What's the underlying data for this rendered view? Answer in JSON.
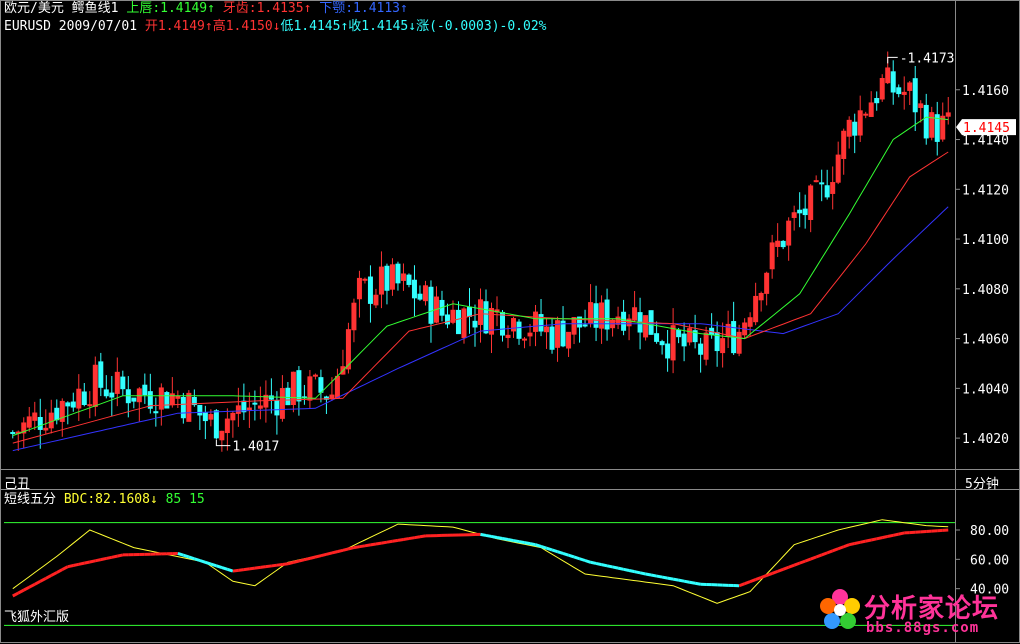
{
  "header": {
    "line1": [
      {
        "text": "欧元/美元",
        "color": "#ffffff"
      },
      {
        "text": " 鳄鱼线1 ",
        "color": "#ffffff"
      },
      {
        "text": "上唇:1.4149",
        "color": "#33ff33"
      },
      {
        "text": "↑",
        "color": "#33ff33"
      },
      {
        "text": " 牙齿:1.4135",
        "color": "#ff3333"
      },
      {
        "text": "↑",
        "color": "#ff3333"
      },
      {
        "text": " 下颚:1.4113",
        "color": "#3366ff"
      },
      {
        "text": "↑",
        "color": "#3366ff"
      }
    ],
    "line2": [
      {
        "text": "EURUSD 2009/07/01 ",
        "color": "#ffffff"
      },
      {
        "text": "开1.4149",
        "color": "#ff3333"
      },
      {
        "text": "↑",
        "color": "#ff3333"
      },
      {
        "text": "高1.4150",
        "color": "#ff3333"
      },
      {
        "text": "↓",
        "color": "#ff3333"
      },
      {
        "text": "低1.4145",
        "color": "#33ffff"
      },
      {
        "text": "↑",
        "color": "#33ffff"
      },
      {
        "text": "收1.4145",
        "color": "#33ffff"
      },
      {
        "text": "↓",
        "color": "#33ffff"
      },
      {
        "text": "涨(-0.0003)-0.02%",
        "color": "#33ffff"
      }
    ]
  },
  "divider": {
    "left_label": "己丑",
    "right_label": "5分钟"
  },
  "indicator_header": [
    {
      "text": "短线五分",
      "color": "#ffffff"
    },
    {
      "text": " BDC:82.1608",
      "color": "#ffff33"
    },
    {
      "text": "↓",
      "color": "#ffff33"
    },
    {
      "text": " 85",
      "color": "#33ff33"
    },
    {
      "text": " 15",
      "color": "#33ff33"
    }
  ],
  "watermark_left": "飞狐外汇版",
  "logo": {
    "title": "分析家论坛",
    "url": "bbs.88gs.com"
  },
  "colors": {
    "up_candle": "#ff3333",
    "down_candle": "#33ffff",
    "lips": "#33ff33",
    "teeth": "#ff3333",
    "jaw": "#3333ff",
    "bdc": "#ffff33",
    "signal_red": "#ff2222",
    "signal_cyan": "#33ffff",
    "level_line": "#33ff33"
  },
  "chart_data": [
    {
      "type": "candlestick",
      "title": "欧元/美元 鳄鱼线1",
      "yticks": [
        "1.4020",
        "1.4040",
        "1.4060",
        "1.4080",
        "1.4100",
        "1.4120",
        "1.4140",
        "1.4160"
      ],
      "ylim": [
        1.401,
        1.418
      ],
      "last_price_label": "1.4145",
      "annotations": [
        {
          "text": "1.4173",
          "value": 1.4173,
          "bar_index": 159
        },
        {
          "text": "1.4017",
          "value": 1.4017,
          "bar_index": 37
        }
      ],
      "ohlc_keyframes": [
        {
          "i": 0,
          "c": 1.4022
        },
        {
          "i": 15,
          "c": 1.4042
        },
        {
          "i": 20,
          "c": 1.4039
        },
        {
          "i": 30,
          "c": 1.4037
        },
        {
          "i": 36,
          "c": 1.4026
        },
        {
          "i": 44,
          "c": 1.4033
        },
        {
          "i": 52,
          "c": 1.404
        },
        {
          "i": 58,
          "c": 1.4038
        },
        {
          "i": 61,
          "c": 1.4063
        },
        {
          "i": 63,
          "c": 1.4078
        },
        {
          "i": 68,
          "c": 1.4083
        },
        {
          "i": 72,
          "c": 1.408
        },
        {
          "i": 78,
          "c": 1.407
        },
        {
          "i": 88,
          "c": 1.407
        },
        {
          "i": 98,
          "c": 1.4062
        },
        {
          "i": 112,
          "c": 1.4072
        },
        {
          "i": 120,
          "c": 1.4058
        },
        {
          "i": 126,
          "c": 1.4055
        },
        {
          "i": 132,
          "c": 1.4063
        },
        {
          "i": 136,
          "c": 1.4085
        },
        {
          "i": 141,
          "c": 1.4105
        },
        {
          "i": 147,
          "c": 1.4118
        },
        {
          "i": 152,
          "c": 1.4145
        },
        {
          "i": 158,
          "c": 1.4162
        },
        {
          "i": 163,
          "c": 1.4158
        },
        {
          "i": 167,
          "c": 1.4145
        }
      ],
      "lips_keyframes": [
        {
          "i": 0,
          "v": 1.4021
        },
        {
          "i": 20,
          "v": 1.4037
        },
        {
          "i": 40,
          "v": 1.4037
        },
        {
          "i": 55,
          "v": 1.4036
        },
        {
          "i": 68,
          "v": 1.4065
        },
        {
          "i": 80,
          "v": 1.4074
        },
        {
          "i": 95,
          "v": 1.4068
        },
        {
          "i": 110,
          "v": 1.4068
        },
        {
          "i": 125,
          "v": 1.4062
        },
        {
          "i": 133,
          "v": 1.406
        },
        {
          "i": 143,
          "v": 1.4078
        },
        {
          "i": 152,
          "v": 1.411
        },
        {
          "i": 160,
          "v": 1.414
        },
        {
          "i": 166,
          "v": 1.4149
        },
        {
          "i": 170,
          "v": 1.4148
        }
      ],
      "teeth_keyframes": [
        {
          "i": 0,
          "v": 1.4018
        },
        {
          "i": 25,
          "v": 1.4033
        },
        {
          "i": 45,
          "v": 1.4035
        },
        {
          "i": 60,
          "v": 1.4036
        },
        {
          "i": 72,
          "v": 1.4063
        },
        {
          "i": 85,
          "v": 1.407
        },
        {
          "i": 100,
          "v": 1.4068
        },
        {
          "i": 120,
          "v": 1.4066
        },
        {
          "i": 133,
          "v": 1.406
        },
        {
          "i": 145,
          "v": 1.407
        },
        {
          "i": 155,
          "v": 1.4098
        },
        {
          "i": 163,
          "v": 1.4125
        },
        {
          "i": 170,
          "v": 1.4135
        }
      ],
      "jaw_keyframes": [
        {
          "i": 0,
          "v": 1.4015
        },
        {
          "i": 30,
          "v": 1.403
        },
        {
          "i": 55,
          "v": 1.4032
        },
        {
          "i": 70,
          "v": 1.4048
        },
        {
          "i": 85,
          "v": 1.4063
        },
        {
          "i": 100,
          "v": 1.4066
        },
        {
          "i": 125,
          "v": 1.4066
        },
        {
          "i": 140,
          "v": 1.4062
        },
        {
          "i": 150,
          "v": 1.407
        },
        {
          "i": 160,
          "v": 1.4092
        },
        {
          "i": 170,
          "v": 1.4113
        }
      ]
    },
    {
      "type": "line",
      "title": "短线五分",
      "yticks": [
        "80.00",
        "60.00",
        "40.00"
      ],
      "ylim": [
        20,
        95
      ],
      "levels": [
        85,
        15
      ],
      "series": [
        {
          "name": "BDC",
          "keyframes": [
            {
              "i": 0,
              "v": 40
            },
            {
              "i": 8,
              "v": 62
            },
            {
              "i": 14,
              "v": 80
            },
            {
              "i": 22,
              "v": 68
            },
            {
              "i": 35,
              "v": 58
            },
            {
              "i": 40,
              "v": 45
            },
            {
              "i": 44,
              "v": 42
            },
            {
              "i": 50,
              "v": 58
            },
            {
              "i": 60,
              "v": 66
            },
            {
              "i": 70,
              "v": 84
            },
            {
              "i": 80,
              "v": 82
            },
            {
              "i": 88,
              "v": 74
            },
            {
              "i": 96,
              "v": 68
            },
            {
              "i": 104,
              "v": 50
            },
            {
              "i": 112,
              "v": 46
            },
            {
              "i": 120,
              "v": 42
            },
            {
              "i": 128,
              "v": 30
            },
            {
              "i": 134,
              "v": 38
            },
            {
              "i": 142,
              "v": 70
            },
            {
              "i": 150,
              "v": 80
            },
            {
              "i": 158,
              "v": 87
            },
            {
              "i": 166,
              "v": 83
            },
            {
              "i": 170,
              "v": 82.16
            }
          ]
        },
        {
          "name": "Signal",
          "keyframes": [
            {
              "i": 0,
              "v": 35
            },
            {
              "i": 10,
              "v": 55
            },
            {
              "i": 20,
              "v": 63
            },
            {
              "i": 30,
              "v": 64
            },
            {
              "i": 40,
              "v": 52
            },
            {
              "i": 50,
              "v": 57
            },
            {
              "i": 62,
              "v": 68
            },
            {
              "i": 75,
              "v": 76
            },
            {
              "i": 85,
              "v": 77
            },
            {
              "i": 95,
              "v": 70
            },
            {
              "i": 105,
              "v": 58
            },
            {
              "i": 115,
              "v": 50
            },
            {
              "i": 125,
              "v": 43
            },
            {
              "i": 132,
              "v": 42
            },
            {
              "i": 142,
              "v": 56
            },
            {
              "i": 152,
              "v": 70
            },
            {
              "i": 162,
              "v": 78
            },
            {
              "i": 170,
              "v": 80
            }
          ]
        }
      ]
    }
  ]
}
